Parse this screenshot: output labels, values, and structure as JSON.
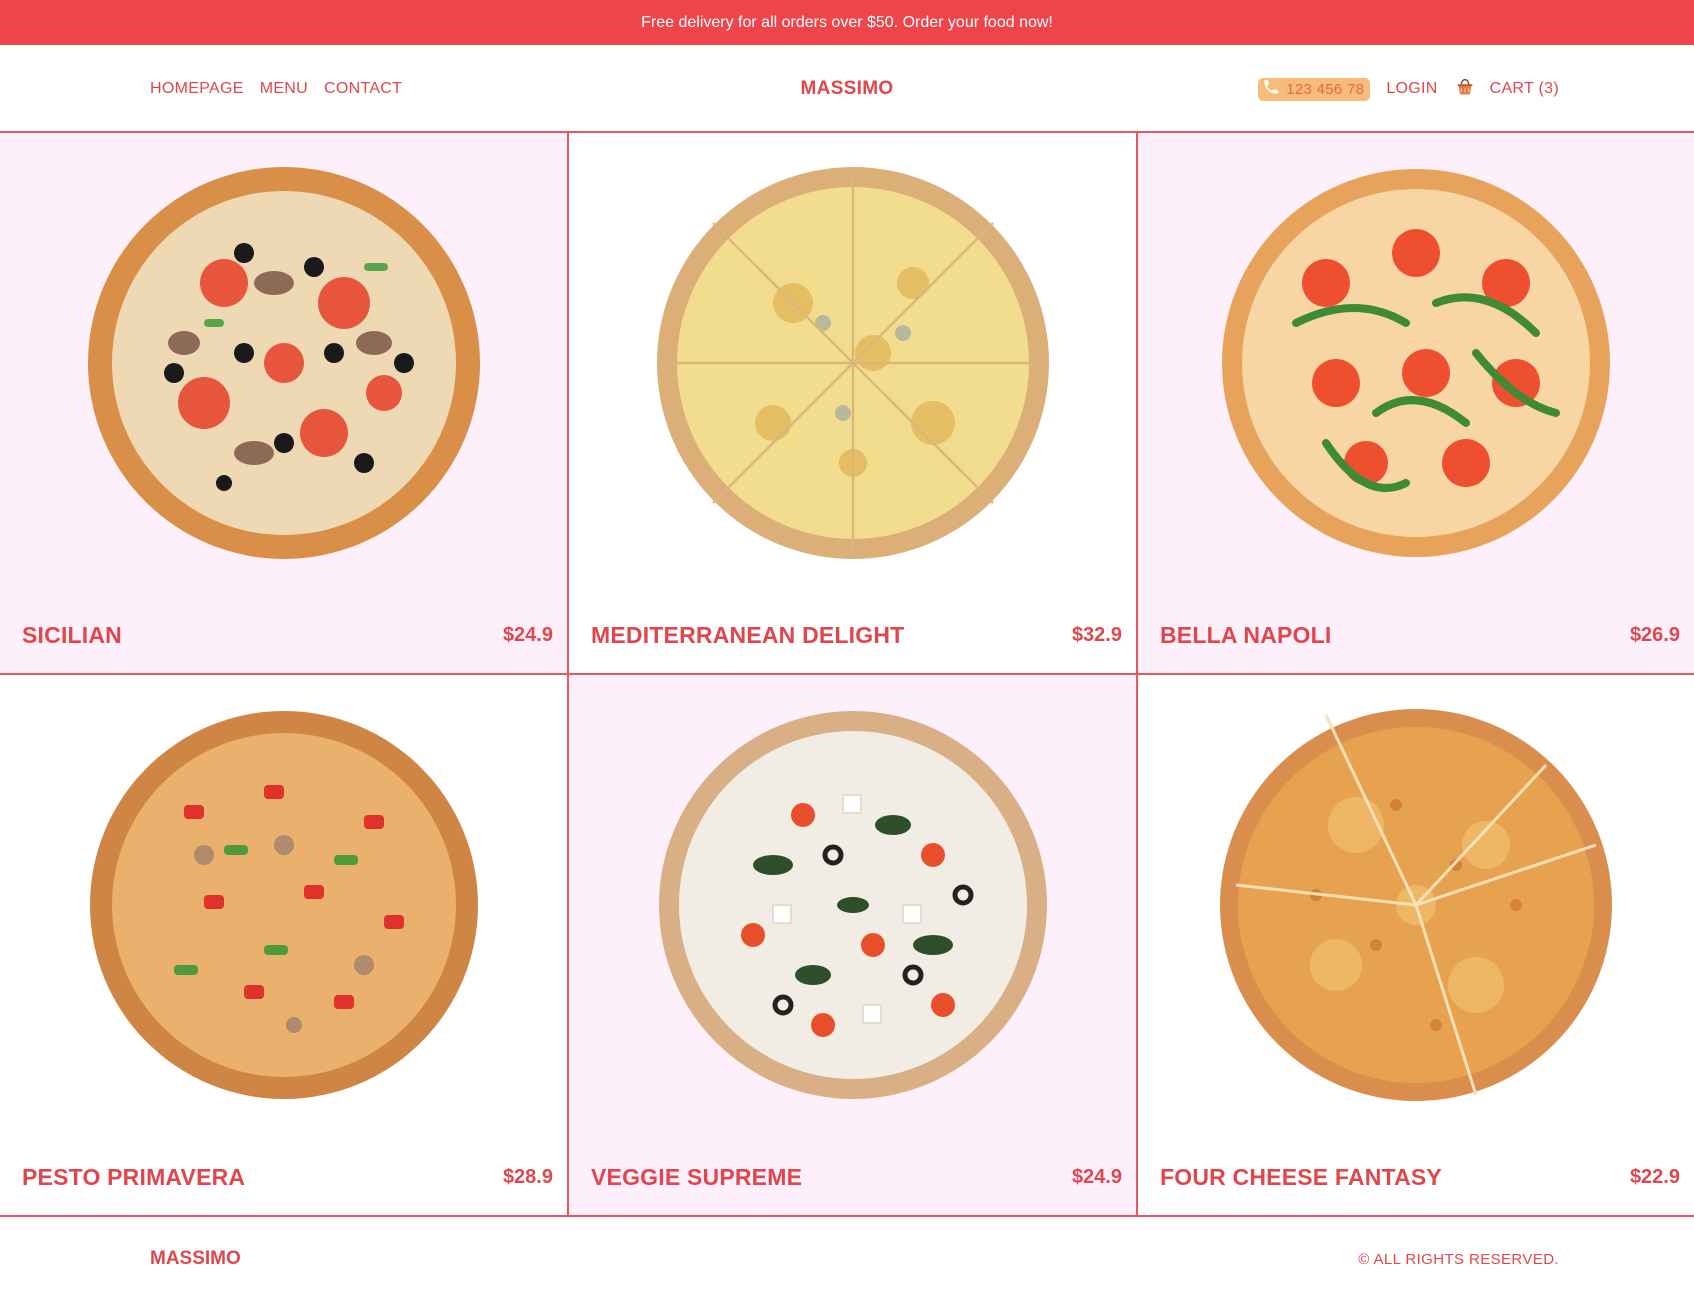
{
  "promo": {
    "text": "Free delivery for all orders over $50. Order your food now!"
  },
  "nav": {
    "homepage": "HOMEPAGE",
    "menu": "MENU",
    "contact": "CONTACT"
  },
  "brand": "MASSIMO",
  "header": {
    "phone": "123 456 78",
    "login": "LOGIN",
    "cart": "CART (3)"
  },
  "products": [
    {
      "name": "SICILIAN",
      "price": "$24.9"
    },
    {
      "name": "MEDITERRANEAN DELIGHT",
      "price": "$32.9"
    },
    {
      "name": "BELLA NAPOLI",
      "price": "$26.9"
    },
    {
      "name": "PESTO PRIMAVERA",
      "price": "$28.9"
    },
    {
      "name": "VEGGIE SUPREME",
      "price": "$24.9"
    },
    {
      "name": "FOUR CHEESE FANTASY",
      "price": "$22.9"
    }
  ],
  "footer": {
    "brand": "MASSIMO",
    "rights": "© ALL RIGHTS RESERVED."
  },
  "colors": {
    "accent": "#e0464c",
    "promo_bg": "#ee454b",
    "pink_bg": "#fdf0fb",
    "phone_bg": "#f7bb7a"
  },
  "icons": {
    "phone": "phone-icon",
    "cart": "basket-icon"
  }
}
